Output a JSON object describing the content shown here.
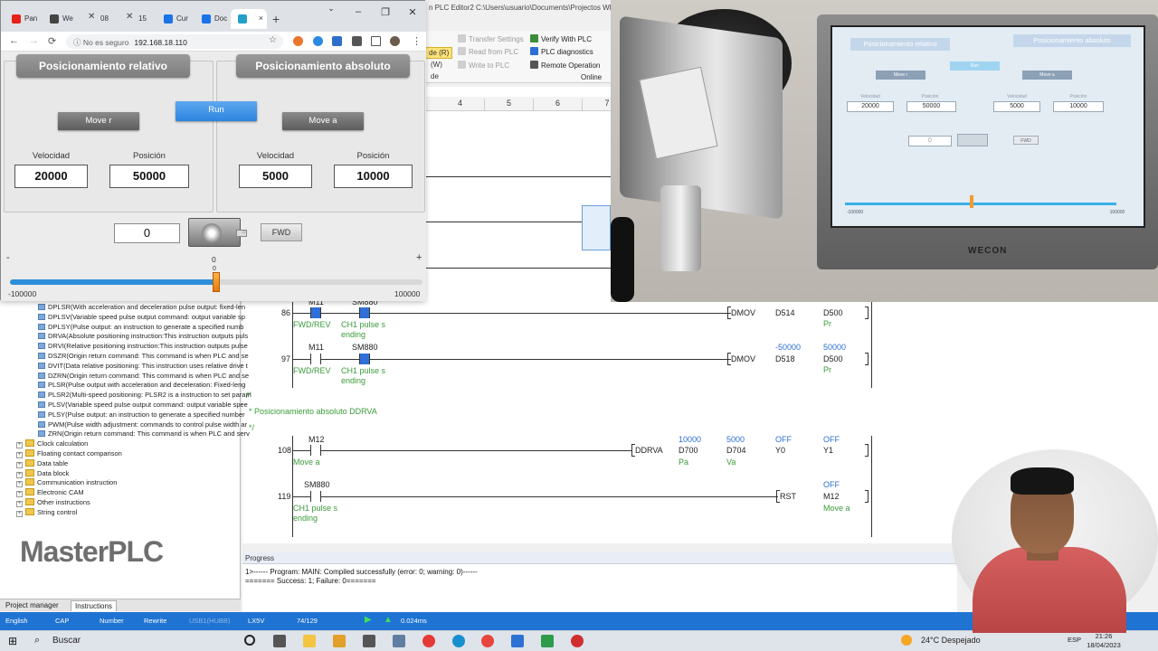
{
  "browser": {
    "tabs": [
      {
        "label": "Pan",
        "color": "#e62117"
      },
      {
        "label": "We",
        "color": "#444444"
      },
      {
        "label": "08",
        "color": "#444444"
      },
      {
        "label": "15",
        "color": "#444444"
      },
      {
        "label": "Cur",
        "color": "#1a73e8"
      },
      {
        "label": "Doc",
        "color": "#1a73e8"
      },
      {
        "label": "",
        "color": "#22a0c8"
      }
    ],
    "active_tab_close": "×",
    "new_tab": "+",
    "controls": {
      "minimize": "–",
      "restore": "❐",
      "close": "✕"
    },
    "back": "←",
    "forward": "→",
    "reload": "⟳",
    "security": "ⓘ No es seguro",
    "url": "192.168.18.110"
  },
  "hmi": {
    "left_title": "Posicionamiento relativo",
    "right_title": "Posicionamiento absoluto",
    "run_label": "Run",
    "move_r_label": "Move r",
    "move_a_label": "Move a",
    "velocidad_label": "Velocidad",
    "posicion_label": "Posición",
    "rel_velocidad": "20000",
    "rel_posicion": "50000",
    "abs_velocidad": "5000",
    "abs_posicion": "10000",
    "current_pos": "0",
    "equals": "=",
    "fwd_label": "FWD",
    "slider_minus": "-",
    "slider_plus": "+",
    "slider_min": "-100000",
    "slider_max": "100000",
    "slider_value_top": "0",
    "slider_value_mid": "0",
    "slider_fraction": 0.5
  },
  "plc": {
    "title": "n PLC Editor2  C:\\Users\\usuario\\Documents\\Projectos WE",
    "ribbon": {
      "mode": "de (R)",
      "w": "(W)",
      "ui": "de",
      "transfer": "Transfer Settings",
      "read": "Read from PLC",
      "write": "Write to PLC",
      "verify": "Verify With PLC",
      "diag": "PLC diagnostics",
      "remote": "Remote Operation",
      "online": "Online"
    },
    "columns": [
      "4",
      "5",
      "6",
      "7"
    ],
    "rungs": [
      {
        "num": "86",
        "c1": "M11",
        "c2": "SM880",
        "c1_desc": "FWD/REV",
        "c2_desc": "CH1 pulse s\nending",
        "instr": "DMOV",
        "op1": "D514",
        "op2": "D500",
        "op2_desc": "Pr",
        "top1": "",
        "top2": ""
      },
      {
        "num": "97",
        "c1": "M11",
        "c2": "SM880",
        "c1_desc": "FWD/REV",
        "c2_desc": "CH1 pulse s\nending",
        "instr": "DMOV",
        "op1": "D518",
        "op2": "D500",
        "op2_desc": "Pr",
        "top1": "-50000",
        "top2": "50000"
      }
    ],
    "comment": "Posicionamiento absoluto DDRVA",
    "comment_open": "/*",
    "comment_close": "*/",
    "rung108": {
      "num": "108",
      "c1": "M12",
      "c1_desc": "Move a",
      "instr": "DDRVA",
      "ops": [
        "D700",
        "D704",
        "Y0",
        "Y1"
      ],
      "tops": [
        "10000",
        "5000",
        "OFF",
        "OFF"
      ],
      "descs": [
        "Pa",
        "Va",
        "",
        ""
      ]
    },
    "rung119": {
      "num": "119",
      "c1": "SM880",
      "c1_desc": "CH1 pulse s\nending",
      "instr": "RST",
      "op": "M12",
      "top": "OFF",
      "desc": "Move a"
    },
    "tree": [
      {
        "label": "DPLSR(With acceleration and deceleration pulse output:  fixed-len",
        "type": "item"
      },
      {
        "label": "DPLSV(Variable speed pulse output command:  output variable sp",
        "type": "item"
      },
      {
        "label": "DPLSY(Pulse output:  an instruction to generate a specified numb",
        "type": "item"
      },
      {
        "label": "DRVA(Absolute positioning instruction:This instruction outputs puls",
        "type": "item"
      },
      {
        "label": "DRVI(Relative positioning instruction:This instruction outputs pulse",
        "type": "item"
      },
      {
        "label": "DSZR(Origin return command:  This command is when PLC and se",
        "type": "item"
      },
      {
        "label": "DVIT(Data relative positioning:  This instruction uses relative drive t",
        "type": "item"
      },
      {
        "label": "DZRN(Origin return command:  This command is when PLC and se",
        "type": "item"
      },
      {
        "label": "PLSR(Pulse output with acceleration and deceleration:  Fixed-leng",
        "type": "item"
      },
      {
        "label": "PLSR2(Multi-speed positioning: PLSR2 is a instruction to set param",
        "type": "item"
      },
      {
        "label": "PLSV(Variable speed pulse output command:  output variable spee",
        "type": "item"
      },
      {
        "label": "PLSY(Pulse output:  an instruction to generate a specified number",
        "type": "item"
      },
      {
        "label": "PWM(Pulse width adjustment:  commands to control pulse width ar",
        "type": "item"
      },
      {
        "label": "ZRN(Origin return command:  This command is when PLC and serv",
        "type": "item"
      },
      {
        "label": "Clock calculation",
        "type": "folder"
      },
      {
        "label": "Floating contact comparison",
        "type": "folder"
      },
      {
        "label": "Data table",
        "type": "folder"
      },
      {
        "label": "Data block",
        "type": "folder"
      },
      {
        "label": "Communication instruction",
        "type": "folder"
      },
      {
        "label": "Electronic CAM",
        "type": "folder"
      },
      {
        "label": "Other instructions",
        "type": "folder"
      },
      {
        "label": "String control",
        "type": "folder"
      }
    ],
    "brand": "MasterPLC",
    "tabs": {
      "project": "Project manager",
      "instructions": "Instructions"
    },
    "progress": {
      "title": "Progress",
      "line1": "1>------ Program: MAIN: Compiled successfully (error: 0; warning: 0)------",
      "line2": "======= Success: 1; Failure: 0======="
    },
    "status": {
      "lang": "English",
      "cap": "CAP",
      "number": "Number",
      "rewrite": "Rewrite",
      "usb": "USB1(HUBB)",
      "model": "LX5V",
      "steps": "74/129",
      "scan": "0.024ms"
    }
  },
  "taskbar": {
    "search": "Buscar",
    "weather": "24°C  Despejado",
    "lang": "ESP",
    "time": "21:26",
    "date": "18/04/2023"
  },
  "photo_hmi": {
    "left_title": "Posicionamiento relativo",
    "right_title": "Posicionamiento absoluto",
    "run": "Run",
    "move_r": "Move r",
    "move_a": "Move a",
    "v1": "20000",
    "p1": "50000",
    "v2": "5000",
    "p2": "10000",
    "pos": "0",
    "fwd": "FWD",
    "min": "-100000",
    "max": "100000",
    "brand": "WECON",
    "velocidad": "Velocidad",
    "posicion": "Posición"
  }
}
